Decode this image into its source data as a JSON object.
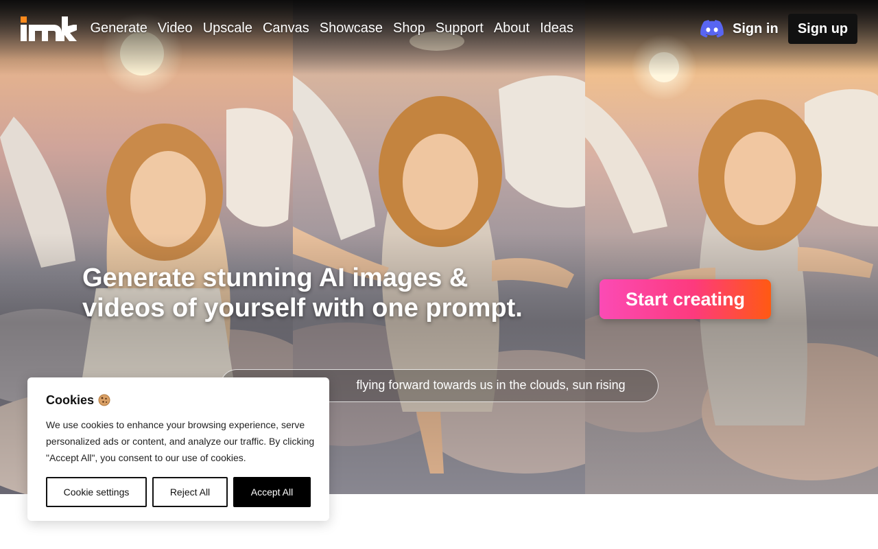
{
  "nav": {
    "links": [
      "Generate",
      "Video",
      "Upscale",
      "Canvas",
      "Showcase",
      "Shop",
      "Support",
      "About",
      "Ideas"
    ],
    "sign_in": "Sign in",
    "sign_up": "Sign up",
    "discord_icon": "discord-icon",
    "discord_color": "#5865f2"
  },
  "hero": {
    "headline_line1": "Generate stunning AI images &",
    "headline_line2": "videos of yourself with one prompt.",
    "cta": "Start creating",
    "prompt_text": "flying forward towards us in the clouds, sun rising",
    "cta_gradient": [
      "#fb4bb5",
      "#fd3a7d",
      "#ff5a12"
    ]
  },
  "cookie": {
    "title": "Cookies",
    "title_icon": "cookie-icon",
    "text": "We use cookies to enhance your browsing experience, serve personalized ads or content, and analyze our traffic. By clicking \"Accept All\", you consent to our use of cookies.",
    "settings_button": "Cookie settings",
    "reject_button": "Reject All",
    "accept_button": "Accept All"
  }
}
